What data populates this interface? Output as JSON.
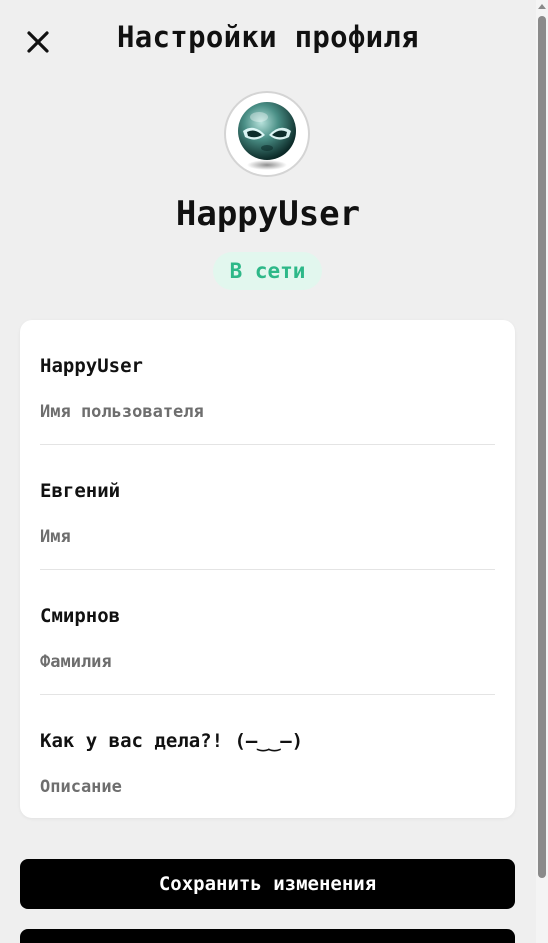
{
  "header": {
    "title": "Настройки профиля",
    "close_icon": "close-icon"
  },
  "profile": {
    "avatar_icon": "alien-avatar",
    "display_name": "HappyUser",
    "status": "В сети",
    "status_color": "#2db888",
    "status_bg": "#e2f7ee"
  },
  "fields": [
    {
      "value": "HappyUser",
      "label": "Имя пользователя"
    },
    {
      "value": "Евгений",
      "label": "Имя"
    },
    {
      "value": "Смирнов",
      "label": "Фамилия"
    },
    {
      "value": "Как у вас дела?! (—‿‿—)",
      "label": "Описание"
    }
  ],
  "actions": {
    "save_label": "Сохранить изменения",
    "secondary_label": ""
  },
  "colors": {
    "background": "#efefef",
    "card": "#ffffff",
    "button": "#000000",
    "button_text": "#ffffff"
  }
}
